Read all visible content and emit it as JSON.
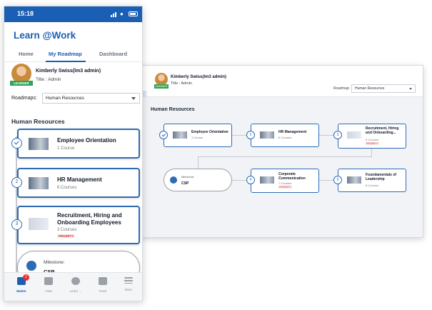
{
  "status": {
    "time": "15:18"
  },
  "app": {
    "title": "Learn @Work"
  },
  "tabs": [
    {
      "label": "Home"
    },
    {
      "label": "My Roadmap"
    },
    {
      "label": "Dashboard"
    }
  ],
  "user": {
    "name": "Kimberly Swiss(lm3 admin)",
    "title": "Title : Admin",
    "badge": "LEARNER"
  },
  "roadmap": {
    "label": "Roadmaps:",
    "selected": "Human Resources"
  },
  "section": {
    "title": "Human Resources"
  },
  "courses": [
    {
      "number": "",
      "title": "Employee Orientation",
      "count": "1 Course",
      "priority": ""
    },
    {
      "number": "2",
      "title": "HR Management",
      "count": "6 Courses",
      "priority": ""
    },
    {
      "number": "3",
      "title": "Recruitment, Hiring and Onboarding Employees",
      "count": "3 Courses",
      "priority": "PRIORITY"
    }
  ],
  "milestone": {
    "label": "Milestone:",
    "value": "CSP"
  },
  "nav": [
    {
      "label": "Matter",
      "badge": "2"
    },
    {
      "label": "Chat"
    },
    {
      "label": "Learn ..."
    },
    {
      "label": "Feed"
    },
    {
      "label": "More"
    }
  ],
  "desktop": {
    "user_name": "Kimberly Swiss(lm3 admin)",
    "user_title": "Title : Admin",
    "badge": "LEARNER",
    "roadmap_label": "Roadmap:",
    "roadmap_value": "Human Resources",
    "section_title": "Human Resources",
    "cards": [
      {
        "number": "",
        "title": "Employee Orientation",
        "count": "1 Course",
        "priority": ""
      },
      {
        "number": "2",
        "title": "HR Management",
        "count": "6 Courses",
        "priority": ""
      },
      {
        "number": "3",
        "title": "Recruitment, Hiring and Onboarding...",
        "count": "3 Courses",
        "priority": "PRIORITY"
      },
      {
        "number": "4",
        "title": "Corporate Communication",
        "count": "7 Courses",
        "priority": "PRIORITY"
      },
      {
        "number": "5",
        "title": "Foundamentals of Leadership",
        "count": "8 Courses",
        "priority": ""
      }
    ],
    "milestone_label": "Milestone:",
    "milestone_value": "CSP"
  },
  "colors": {
    "primary": "#1a5fb4",
    "card_border": "#2d6bb5",
    "learner": "#2fa35a",
    "priority": "#d12f2f"
  }
}
